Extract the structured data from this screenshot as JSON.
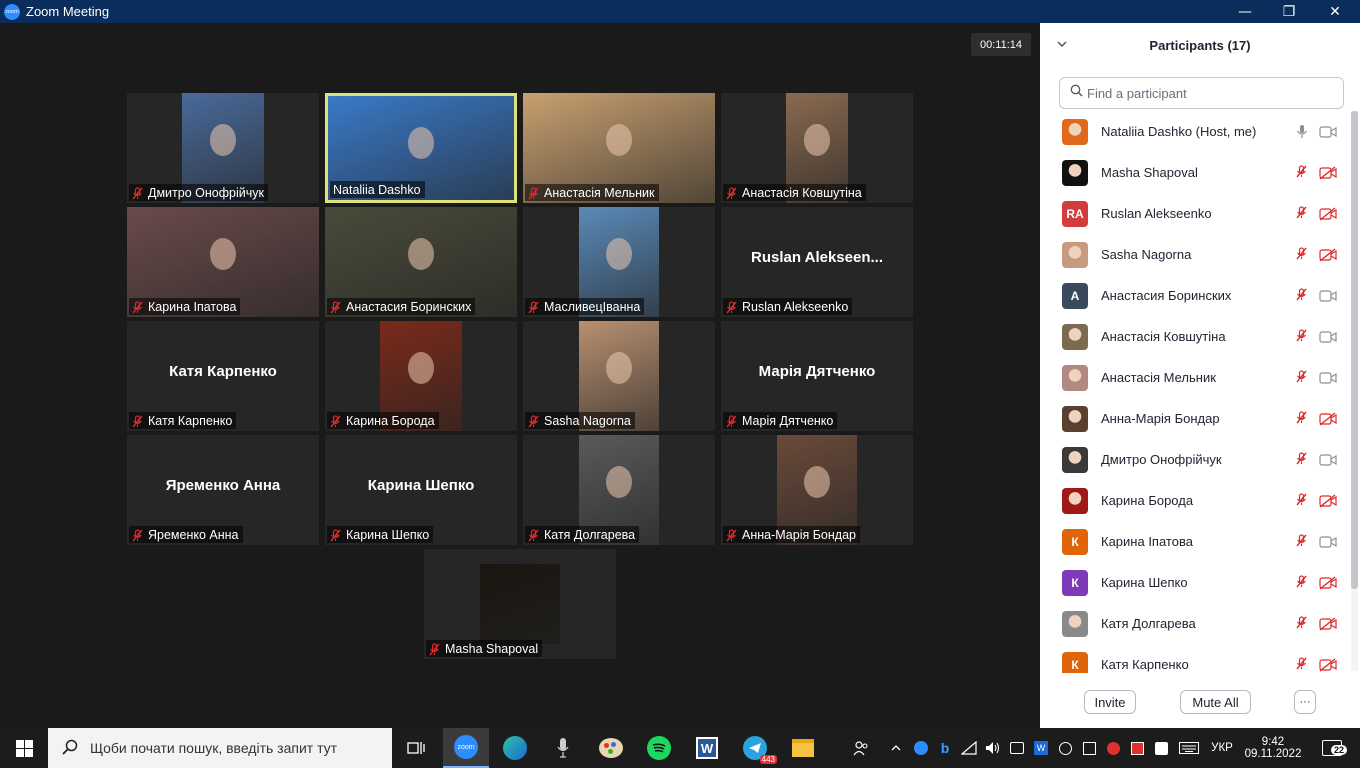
{
  "window": {
    "title": "Zoom Meeting",
    "minimize": "—",
    "maximize": "❐",
    "close": "✕"
  },
  "meeting": {
    "timer": "00:11:14"
  },
  "tiles": [
    {
      "name": "Дмитро Онофрійчук",
      "display": "photo",
      "color": "#4a6a9a"
    },
    {
      "name": "Nataliia Dashko",
      "display": "photo",
      "color": "#3a7ac8",
      "active": true
    },
    {
      "name": "Анастасія Мельник",
      "display": "photo",
      "color": "#c8a070"
    },
    {
      "name": "Анастасія Ковшутіна",
      "display": "photo",
      "color": "#8a6a50"
    },
    {
      "name": "Карина Іпатова",
      "display": "photo",
      "color": "#6a4a4a"
    },
    {
      "name": "Анастасия Боринских",
      "display": "photo",
      "color": "#4a4a3a"
    },
    {
      "name": "МасливецІванна",
      "display": "photo",
      "color": "#5a8ab8"
    },
    {
      "name": "Ruslan Alekseenko",
      "display": "text",
      "center": "Ruslan  Alekseen..."
    },
    {
      "name": "Катя Карпенко",
      "display": "text",
      "center": "Катя Карпенко"
    },
    {
      "name": "Карина Борода",
      "display": "photo",
      "color": "#7a2a1a"
    },
    {
      "name": "Sasha Nagorna",
      "display": "photo",
      "color": "#b89070"
    },
    {
      "name": "Марія Дятченко",
      "display": "text",
      "center": "Марія Дятченко"
    },
    {
      "name": "Яременко Анна",
      "display": "text",
      "center": "Яременко Анна"
    },
    {
      "name": "Карина Шепко",
      "display": "text",
      "center": "Карина Шепко"
    },
    {
      "name": "Катя Долгарева",
      "display": "photo",
      "color": "#5a5a5a"
    },
    {
      "name": "Анна-Марія Бондар",
      "display": "photo",
      "color": "#6a4a3a"
    },
    {
      "name": "Masha Shapoval",
      "display": "photo",
      "color": "#1a1610"
    }
  ],
  "panel": {
    "title": "Participants (17)",
    "search_placeholder": "Find a participant",
    "participants": [
      {
        "name": "Nataliia Dashko (Host, me)",
        "avatar": "photo",
        "color": "#e06a1a",
        "mic": "on",
        "cam": "on"
      },
      {
        "name": "Masha Shapoval",
        "avatar": "photo",
        "color": "#111111",
        "mic": "muted",
        "cam": "off"
      },
      {
        "name": "Ruslan Alekseenko",
        "avatar": "initials",
        "initials": "RA",
        "color": "#d13c3c",
        "mic": "muted",
        "cam": "off"
      },
      {
        "name": "Sasha Nagorna",
        "avatar": "photo",
        "color": "#c89a80",
        "mic": "muted",
        "cam": "off"
      },
      {
        "name": "Анастасия Боринских",
        "avatar": "initials",
        "initials": "А",
        "color": "#3a4a5c",
        "mic": "muted",
        "cam": "on"
      },
      {
        "name": "Анастасія Ковшутіна",
        "avatar": "photo",
        "color": "#7a6a50",
        "mic": "muted",
        "cam": "on"
      },
      {
        "name": "Анастасія Мельник",
        "avatar": "photo",
        "color": "#b08a80",
        "mic": "muted",
        "cam": "on"
      },
      {
        "name": "Анна-Марія Бондар",
        "avatar": "photo",
        "color": "#5a4030",
        "mic": "muted",
        "cam": "off"
      },
      {
        "name": "Дмитро Онофрійчук",
        "avatar": "photo",
        "color": "#3a3a3a",
        "mic": "muted",
        "cam": "on"
      },
      {
        "name": "Карина Борода",
        "avatar": "photo",
        "color": "#a01818",
        "mic": "muted",
        "cam": "off"
      },
      {
        "name": "Карина Іпатова",
        "avatar": "initials",
        "initials": "К",
        "color": "#e0640a",
        "mic": "muted",
        "cam": "on"
      },
      {
        "name": "Карина Шепко",
        "avatar": "initials",
        "initials": "К",
        "color": "#7e3ab8",
        "mic": "muted",
        "cam": "off"
      },
      {
        "name": "Катя Долгарева",
        "avatar": "photo",
        "color": "#8a8a8a",
        "mic": "muted",
        "cam": "off"
      },
      {
        "name": "Катя Карпенко",
        "avatar": "initials",
        "initials": "К",
        "color": "#e0640a",
        "mic": "muted",
        "cam": "off"
      }
    ],
    "invite_label": "Invite",
    "mute_all_label": "Mute All",
    "more_label": "···"
  },
  "taskbar": {
    "search_placeholder": "Щоби почати пошук, введіть запит тут",
    "telegram_badge": "443",
    "language": "УКР",
    "time": "9:42",
    "date": "09.11.2022",
    "notifications": "22",
    "colors": {
      "accent": "#2d8cff",
      "muted": "#e02828"
    }
  }
}
